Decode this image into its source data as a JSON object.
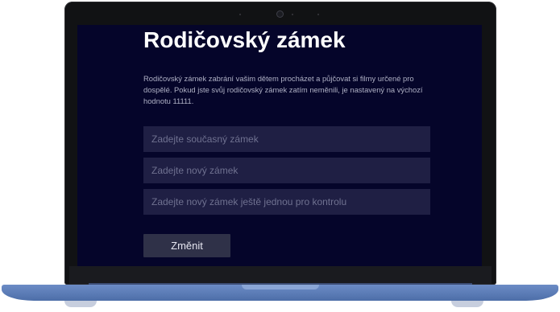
{
  "parental_lock": {
    "title": "Rodičovský zámek",
    "description": "Rodičovský zámek zabrání vašim dětem procházet a půjčovat si filmy určené pro dospělé. Pokud jste svůj rodičovský zámek zatím neměnili, je nastavený na výchozí hodnotu 11111.",
    "current_lock_placeholder": "Zadejte současný zámek",
    "new_lock_placeholder": "Zadejte nový zámek",
    "confirm_lock_placeholder": "Zadejte nový zámek ještě jednou pro kontrolu",
    "change_button": "Změnit"
  },
  "colors": {
    "screen_background": "#05052a",
    "input_background": "#1f1f44",
    "button_background": "#2f3148",
    "laptop_base": "#5b7bb5"
  }
}
